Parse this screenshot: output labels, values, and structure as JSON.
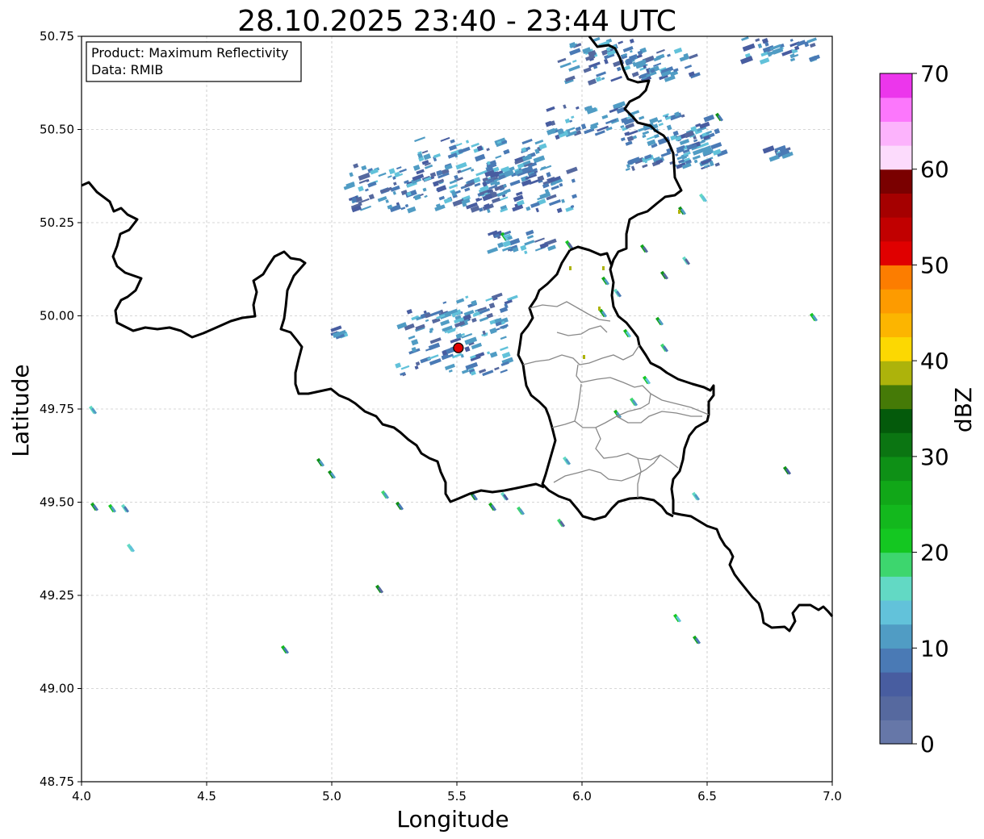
{
  "title": "28.10.2025 23:40 - 23:44 UTC",
  "info_box": {
    "product_line": "Product: Maximum Reflectivity",
    "data_line": "Data: RMIB"
  },
  "chart_data": {
    "type": "heatmap",
    "title": "28.10.2025 23:40 - 23:44 UTC",
    "xlabel": "Longitude",
    "ylabel": "Latitude",
    "xlim": [
      4.0,
      7.0
    ],
    "ylim": [
      48.75,
      50.75
    ],
    "x_ticks": [
      "4.0",
      "4.5",
      "5.0",
      "5.5",
      "6.0",
      "6.5",
      "7.0"
    ],
    "y_ticks": [
      "48.75",
      "49.00",
      "49.25",
      "49.50",
      "49.75",
      "50.00",
      "50.25",
      "50.50",
      "50.75"
    ],
    "grid": true,
    "radar_site": {
      "lon": 5.506,
      "lat": 49.914
    },
    "colorbar": {
      "label": "dBZ",
      "min": 0,
      "max": 70,
      "ticks": [
        "0",
        "10",
        "20",
        "30",
        "40",
        "50",
        "60",
        "70"
      ],
      "colors": [
        "#6677a8",
        "#56699f",
        "#485da0",
        "#4a7ab5",
        "#509cc4",
        "#62c2da",
        "#62d9c4",
        "#3dd66e",
        "#14c721",
        "#13b81d",
        "#11a718",
        "#0e9016",
        "#0b7512",
        "#045a0b",
        "#457a07",
        "#adb30b",
        "#fcd802",
        "#fcb500",
        "#fd9b00",
        "#fc7d00",
        "#e00000",
        "#c10000",
        "#a50000",
        "#7a0000",
        "#fcdbfc",
        "#fcb3fc",
        "#fc77fc",
        "#ec36ec"
      ]
    }
  }
}
